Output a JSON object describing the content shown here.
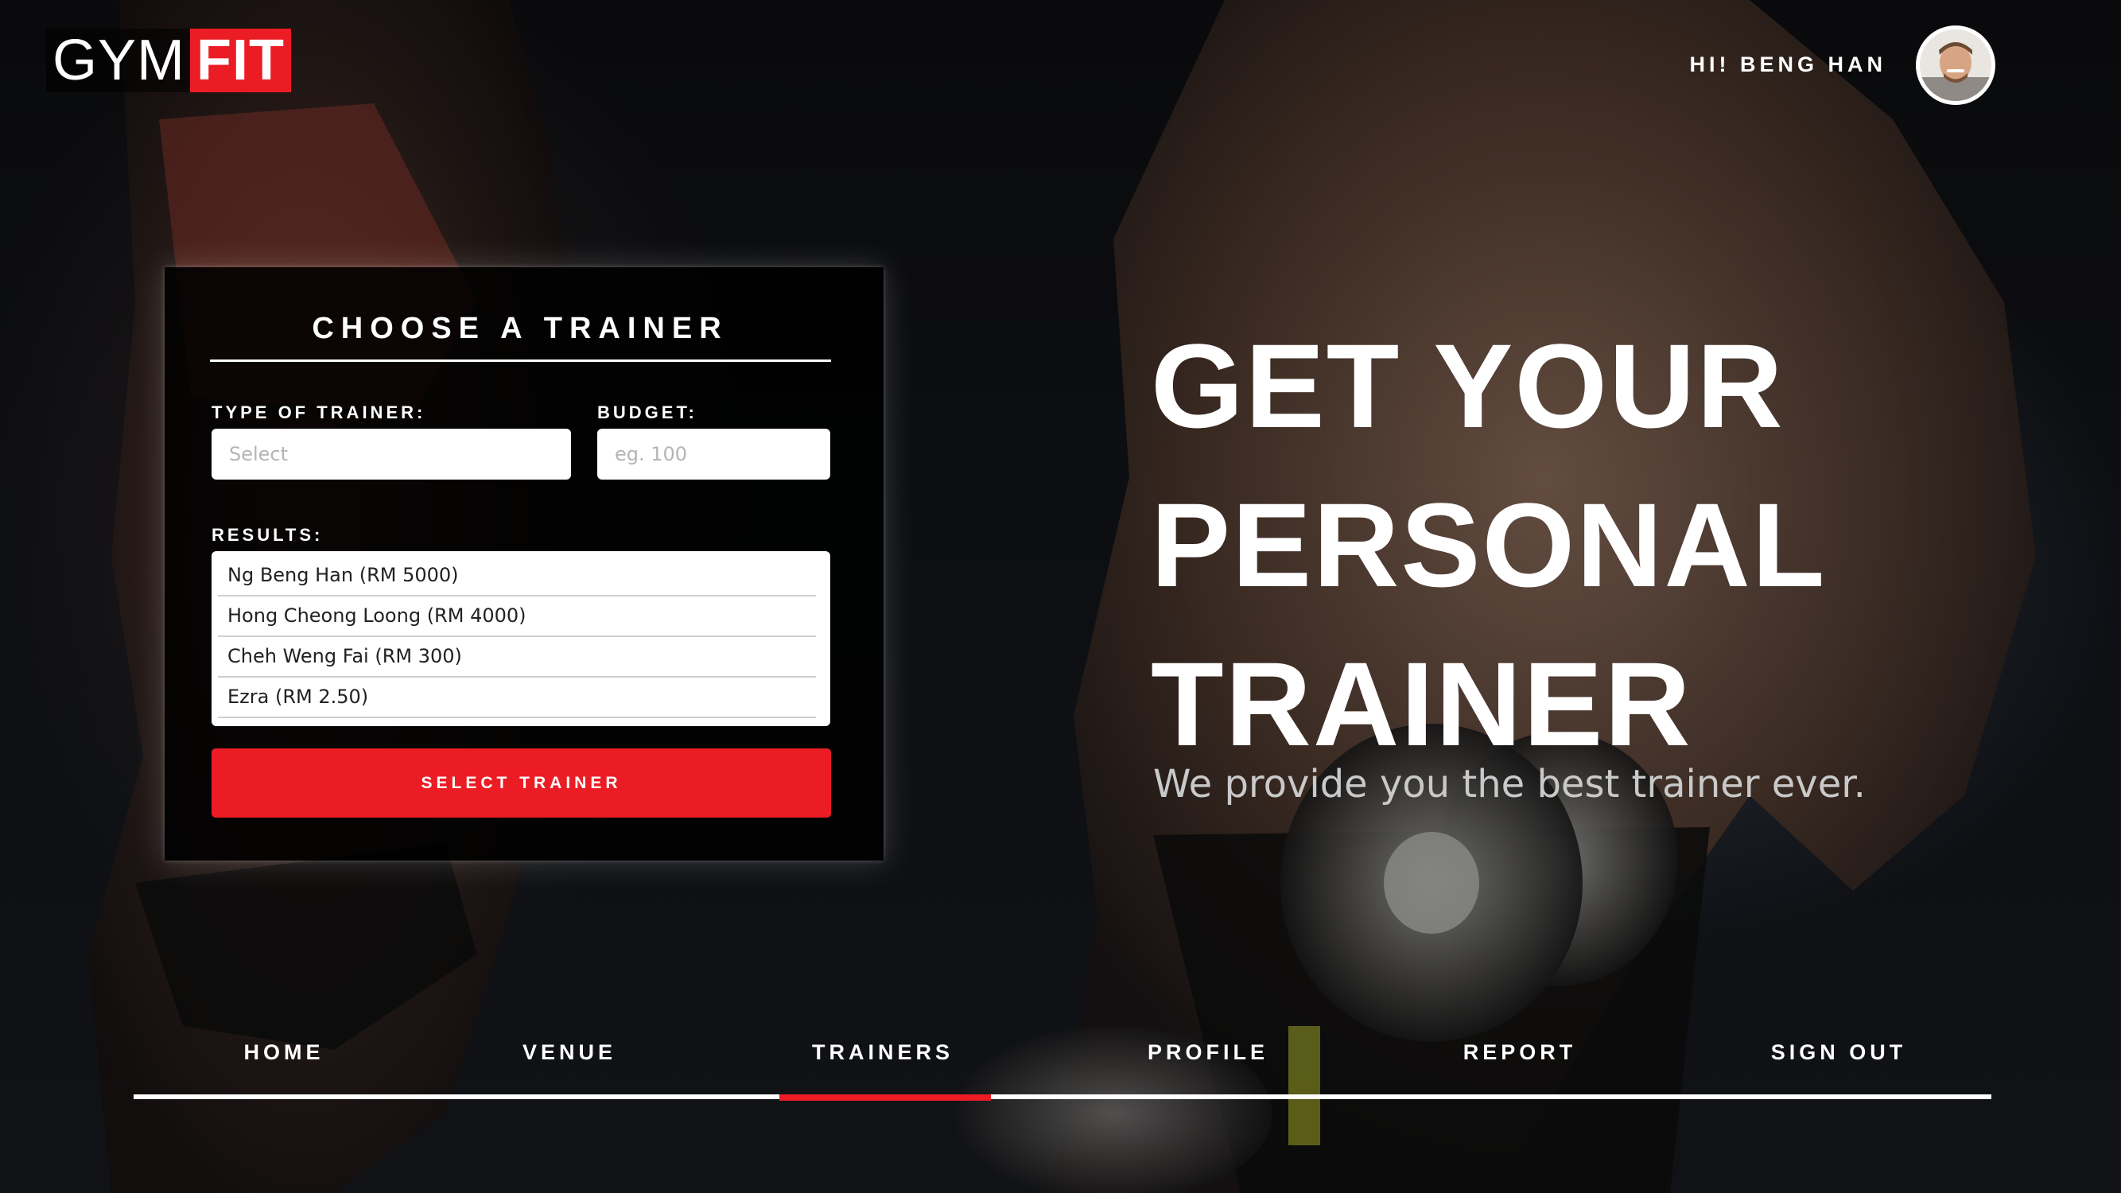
{
  "header": {
    "logo": {
      "part1": "GYM",
      "part2": "FIT"
    },
    "greeting": "HI! BENG HAN",
    "avatar_icon": "user-avatar"
  },
  "panel": {
    "title": "CHOOSE A TRAINER",
    "type_label": "TYPE OF TRAINER:",
    "type_placeholder": "Select",
    "budget_label": "BUDGET:",
    "budget_placeholder": "eg. 100",
    "results_label": "RESULTS:",
    "results": [
      "Ng Beng Han (RM 5000)",
      "Hong Cheong Loong (RM 4000)",
      "Cheh Weng Fai (RM 300)",
      "Ezra (RM 2.50)"
    ],
    "select_button": "SELECT TRAINER"
  },
  "hero": {
    "line1": "GET YOUR",
    "line2": "PERSONAL",
    "line3": "TRAINER",
    "tagline": "We provide you the best trainer ever."
  },
  "nav": {
    "items": [
      "HOME",
      "VENUE",
      "TRAINERS",
      "PROFILE",
      "REPORT",
      "SIGN OUT"
    ],
    "active": "TRAINERS"
  },
  "colors": {
    "accent": "#ec1c24",
    "text": "#ffffff"
  }
}
